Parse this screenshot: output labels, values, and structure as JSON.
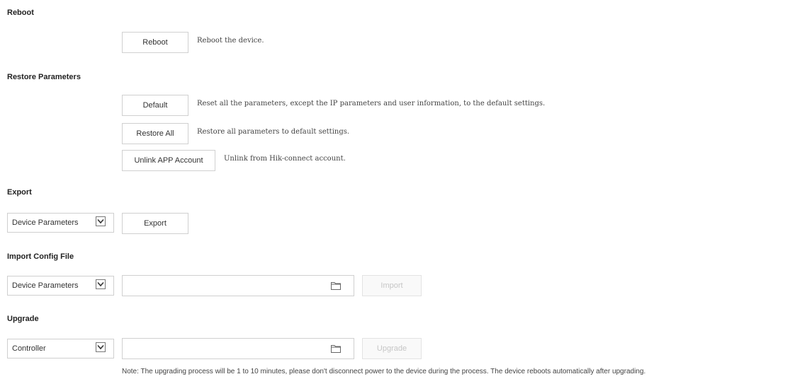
{
  "reboot": {
    "heading": "Reboot",
    "button": "Reboot",
    "description": "Reboot the device."
  },
  "restore": {
    "heading": "Restore Parameters",
    "default_button": "Default",
    "default_description": "Reset all the parameters, except the IP parameters and user information, to the default settings.",
    "restore_all_button": "Restore All",
    "restore_all_description": "Restore all parameters to default settings.",
    "unlink_button": "Unlink APP Account",
    "unlink_description": "Unlink from Hik-connect account."
  },
  "export": {
    "heading": "Export",
    "select_value": "Device Parameters",
    "button": "Export"
  },
  "import": {
    "heading": "Import Config File",
    "select_value": "Device Parameters",
    "file_value": "",
    "button": "Import"
  },
  "upgrade": {
    "heading": "Upgrade",
    "select_value": "Controller",
    "file_value": "",
    "button": "Upgrade",
    "note": "Note: The upgrading process will be 1 to 10 minutes, please don't disconnect power to the device during the process. The device reboots automatically after upgrading."
  },
  "icons": {
    "dropdown": "chevron-down-icon",
    "browse": "folder-icon"
  },
  "colors": {
    "border": "#d0d0d0",
    "disabled_text": "#c6c6c6"
  }
}
